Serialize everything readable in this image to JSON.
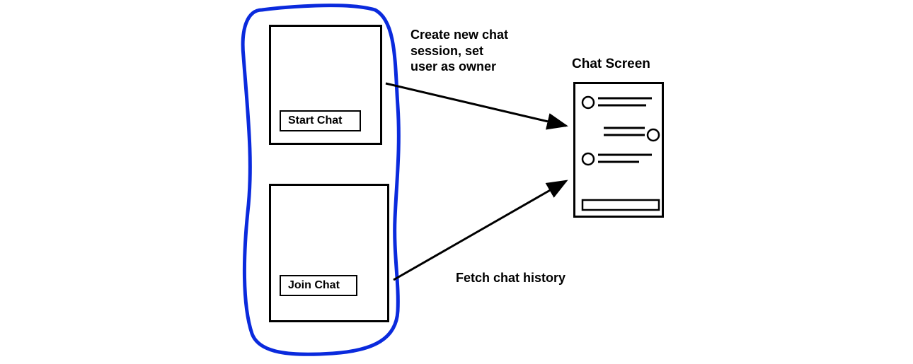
{
  "left": {
    "start_box": {
      "button_label": "Start Chat"
    },
    "join_box": {
      "button_label": "Join Chat"
    }
  },
  "annotations": {
    "create": "Create new chat\nsession, set\nuser as owner",
    "fetch": "Fetch chat history"
  },
  "right": {
    "title": "Chat Screen"
  }
}
